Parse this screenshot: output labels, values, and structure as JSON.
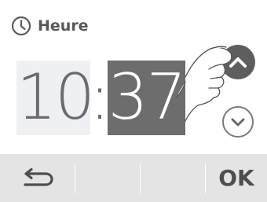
{
  "header": {
    "icon": "clock-icon",
    "title": "Heure"
  },
  "time": {
    "hours": "10",
    "separator": ":",
    "minutes": "37",
    "selected_field": "minutes"
  },
  "controls": {
    "increment_icon": "chevron-up-icon",
    "decrement_icon": "chevron-down-icon",
    "pointer_icon": "pointing-hand-icon"
  },
  "softkeys": {
    "back_icon": "return-arrow-icon",
    "ok_label": "OK"
  },
  "colors": {
    "selected_bg": "#6d6d6d",
    "unselected_bg": "#eef0f3",
    "bar_bg": "#e4e4e4",
    "text": "#585858"
  }
}
